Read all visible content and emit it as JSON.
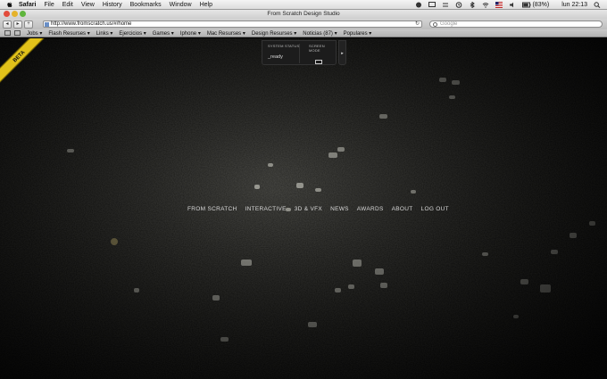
{
  "menubar": {
    "app_name": "Safari",
    "items": [
      "File",
      "Edit",
      "View",
      "History",
      "Bookmarks",
      "Window",
      "Help"
    ],
    "status": {
      "battery": "(83%)",
      "clock": "lun 22:13"
    }
  },
  "window": {
    "title": "From Scratch Design Studio",
    "address": "http://www.fromscratch.us/#/home",
    "search_placeholder": "Google"
  },
  "bookmarks": [
    "Jobs ▾",
    "Flash Resurses ▾",
    "Links ▾",
    "Ejercicios ▾",
    "Games ▾",
    "Iphone ▾",
    "Mac Resurses ▾",
    "Design Resurses ▾",
    "Noticias (87) ▾",
    "Populares ▾"
  ],
  "page": {
    "ribbon_label": "BETA",
    "system_panel": {
      "status_label": "SYSTEM STATUS",
      "status_value": "_ready",
      "screen_label": "SCREEN MODE",
      "toggle_icon": "▸"
    },
    "nav": [
      "FROM SCRATCH",
      "INTERACTIVE",
      "3D & VFX",
      "NEWS",
      "AWARDS",
      "ABOUT",
      "LOG OUT"
    ]
  },
  "colors": {
    "ribbon": "#e2c21a",
    "page_bg": "#141412",
    "nav_text": "#d9d9d9"
  }
}
